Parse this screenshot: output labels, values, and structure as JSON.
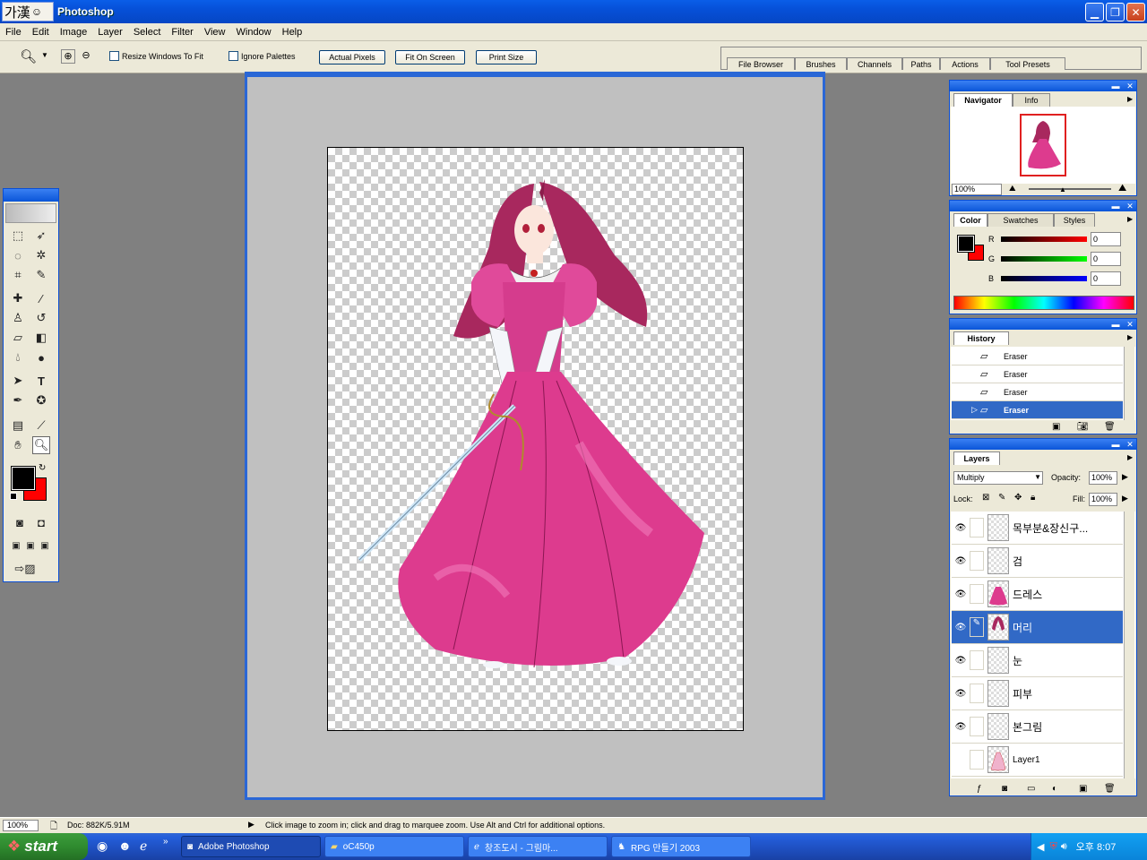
{
  "window": {
    "ime_label": "가漢",
    "title": "Photoshop"
  },
  "menubar": [
    "File",
    "Edit",
    "Image",
    "Layer",
    "Select",
    "Filter",
    "View",
    "Window",
    "Help"
  ],
  "options": {
    "resize_windows": "Resize Windows To Fit",
    "ignore_palettes": "Ignore Palettes",
    "actual_pixels": "Actual Pixels",
    "fit_on_screen": "Fit On Screen",
    "print_size": "Print Size"
  },
  "palette_well": [
    "File Browser",
    "Brushes",
    "Channels",
    "Paths",
    "Actions",
    "Tool Presets"
  ],
  "navigator": {
    "tabs": [
      "Navigator",
      "Info"
    ],
    "zoom": "100%"
  },
  "color": {
    "tabs": [
      "Color",
      "Swatches",
      "Styles"
    ],
    "r_label": "R",
    "g_label": "G",
    "b_label": "B",
    "r": "0",
    "g": "0",
    "b": "0",
    "foreground": "#000000",
    "background": "#ff0000"
  },
  "history": {
    "title": "History",
    "items": [
      "Eraser",
      "Eraser",
      "Eraser",
      "Eraser"
    ],
    "selected_index": 3
  },
  "layers": {
    "title": "Layers",
    "blend_mode": "Multiply",
    "opacity_label": "Opacity:",
    "opacity": "100%",
    "lock_label": "Lock:",
    "fill_label": "Fill:",
    "fill": "100%",
    "items": [
      {
        "name": "목부분&장신구...",
        "visible": true
      },
      {
        "name": "검",
        "visible": true
      },
      {
        "name": "드레스",
        "visible": true
      },
      {
        "name": "머리",
        "visible": true,
        "selected": true
      },
      {
        "name": "눈",
        "visible": true
      },
      {
        "name": "피부",
        "visible": true
      },
      {
        "name": "본그림",
        "visible": true
      },
      {
        "name": "Layer1",
        "visible": false
      }
    ]
  },
  "statusbar": {
    "zoom": "100%",
    "doc": "Doc: 882K/5.91M",
    "hint": "Click image to zoom in; click and drag to marquee zoom.  Use Alt and Ctrl for additional options."
  },
  "taskbar": {
    "start": "start",
    "tasks": [
      "Adobe Photoshop",
      "oC450p",
      "창조도시 - 그림마...",
      "RPG 만들기 2003"
    ],
    "clock": "오후 8:07"
  }
}
